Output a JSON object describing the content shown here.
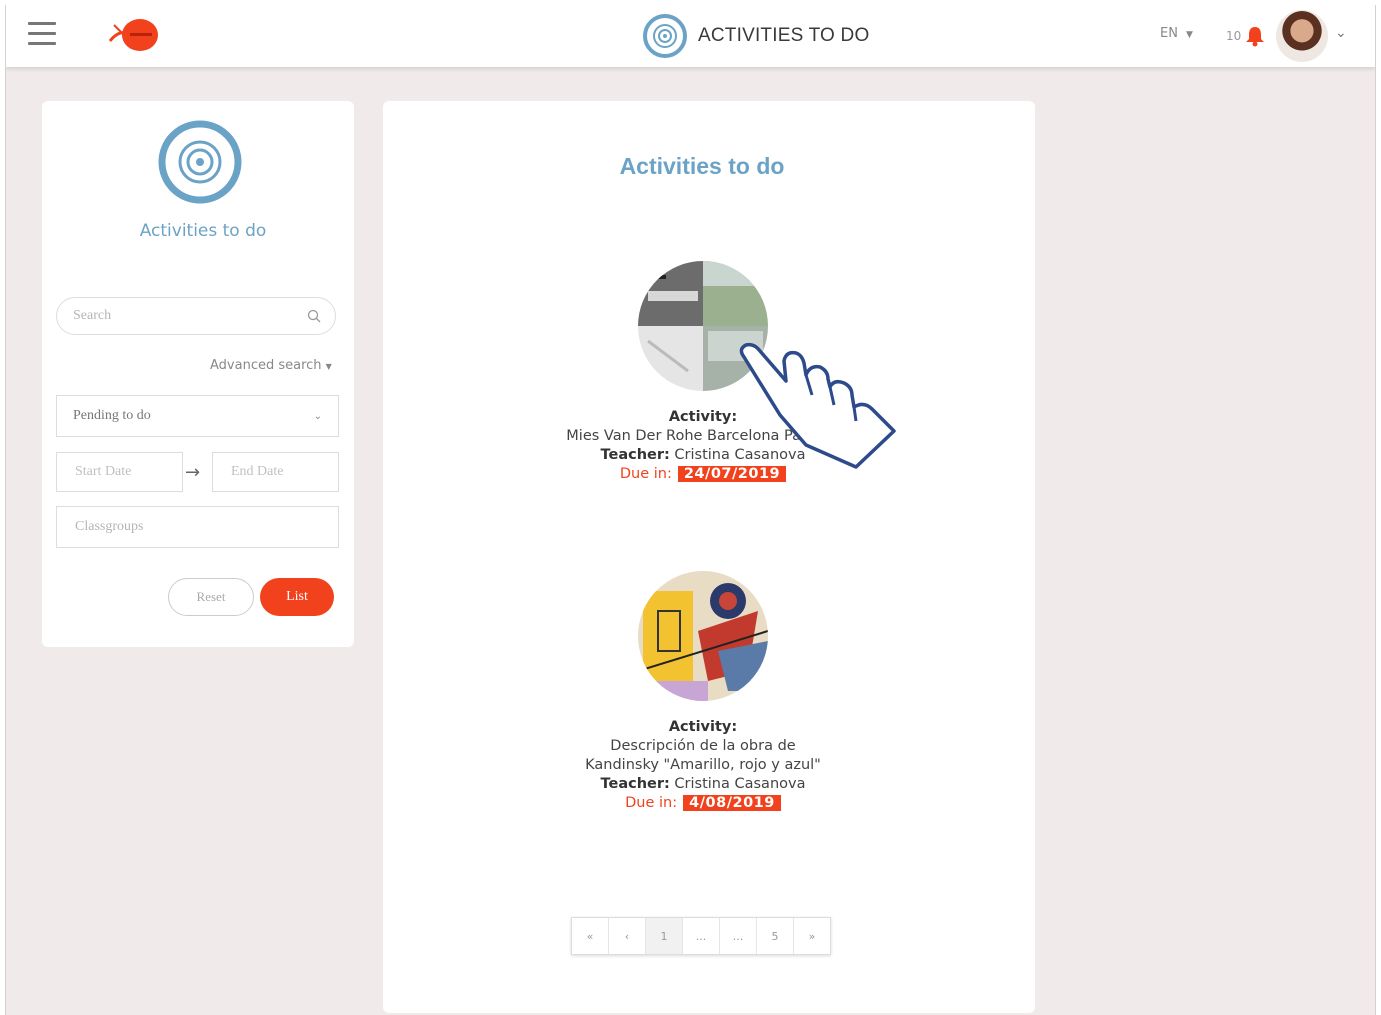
{
  "header": {
    "title": "ACTIVITIES TO DO",
    "language": "EN",
    "notification_count": "10"
  },
  "sidebar": {
    "title": "Activities to do",
    "search_placeholder": "Search",
    "advanced_search": "Advanced search",
    "status_select": "Pending to do",
    "start_date_placeholder": "Start Date",
    "end_date_placeholder": "End Date",
    "classgroups_placeholder": "Classgroups",
    "reset_label": "Reset",
    "list_label": "List"
  },
  "main": {
    "title": "Activities to do",
    "activities": [
      {
        "activity_label": "Activity:",
        "activity_name": "Mies Van Der Rohe Barcelona Pavilion",
        "teacher_label": "Teacher:",
        "teacher": "Cristina Casanova",
        "due_label": "Due in:",
        "due_date": "24/07/2019"
      },
      {
        "activity_label": "Activity:",
        "activity_name_line1": "Descripción de la obra de",
        "activity_name_line2": "Kandinsky \"Amarillo, rojo y azul\"",
        "teacher_label": "Teacher:",
        "teacher": "Cristina Casanova",
        "due_label": "Due in:",
        "due_date": "4/08/2019"
      }
    ],
    "pagination": [
      "«",
      "‹",
      "1",
      "...",
      "...",
      "5",
      "»"
    ]
  },
  "colors": {
    "accent_blue": "#6ba3c6",
    "brand_red": "#f2421d",
    "background": "#f1eaea"
  }
}
